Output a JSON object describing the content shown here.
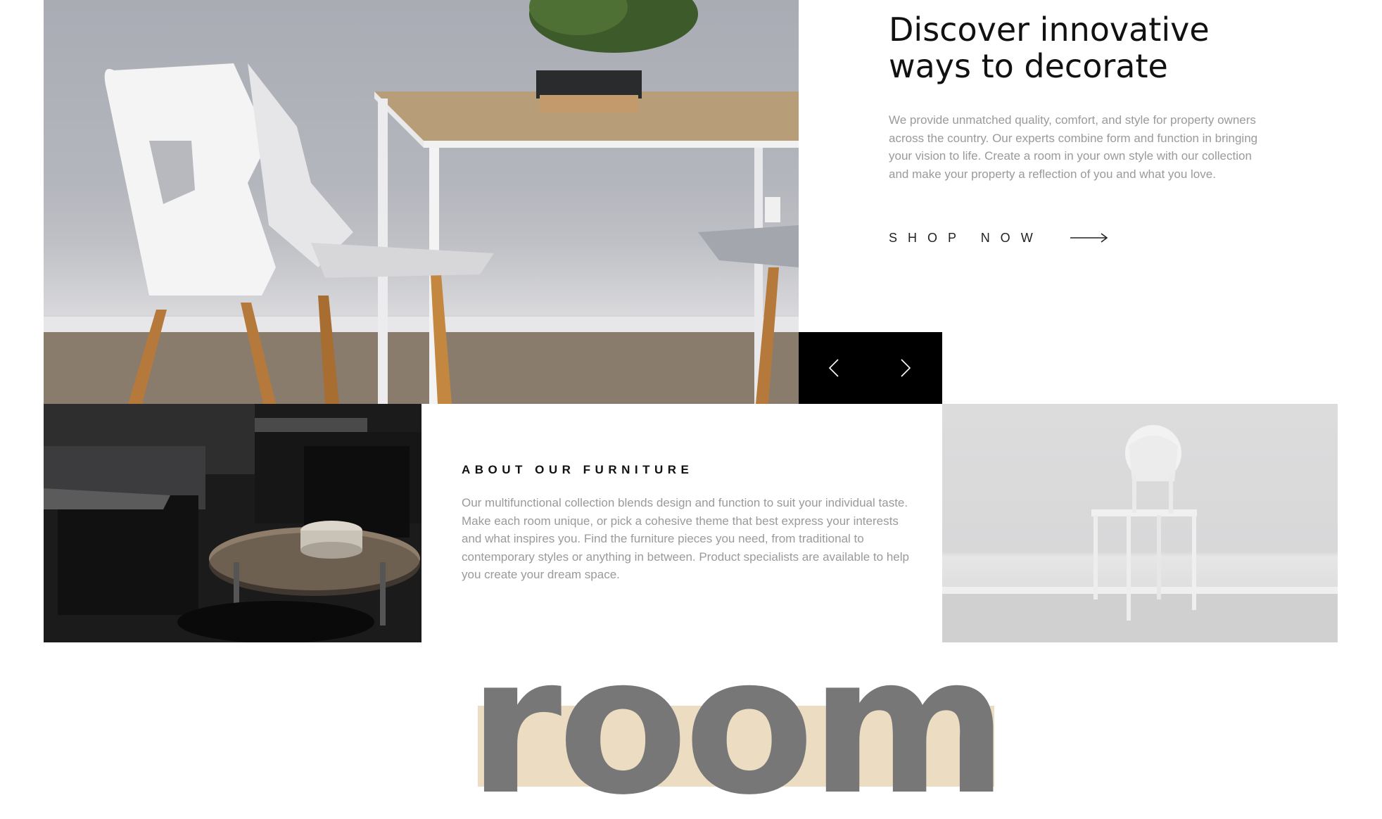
{
  "hero": {
    "title_line1": "Discover innovative",
    "title_line2": "ways to decorate",
    "description": "We provide unmatched quality, comfort, and style for property owners across the country. Our experts combine form and function in bringing your vision to life. Create a room in your own style with our collection and make your property a reflection of you and what you love.",
    "cta_label": "SHOP NOW"
  },
  "about": {
    "title": "ABOUT OUR FURNITURE",
    "description": "Our multifunctional collection blends design and function to suit your individual taste. Make each room unique, or pick a cohesive theme that best express your interests and what inspires you. Find the furniture pieces you need, from traditional to contemporary styles or anything in between. Product specialists are available to help you create your dream space."
  },
  "wordmark": {
    "text": "room"
  },
  "icons": {
    "cta": "arrow-right-icon",
    "prev": "chevron-left-icon",
    "next": "chevron-right-icon"
  },
  "colors": {
    "accent_band": "#ecdcc2",
    "wordmark": "#777777",
    "slider_bg": "#000000",
    "body_text": "#9a9a9a"
  }
}
